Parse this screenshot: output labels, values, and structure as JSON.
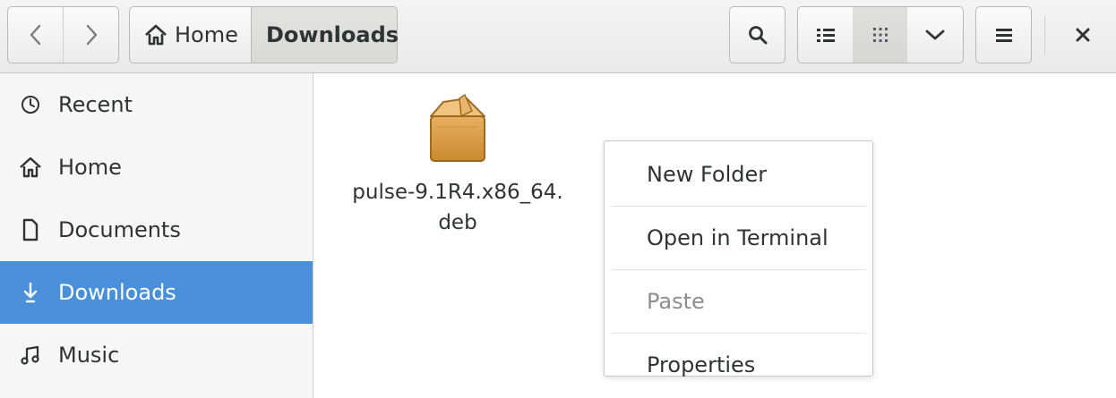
{
  "header": {
    "back_icon": "chevron-left-icon",
    "forward_icon": "chevron-right-icon",
    "breadcrumbs": [
      {
        "label": "Home",
        "icon": "home-icon"
      },
      {
        "label": "Downloads"
      }
    ],
    "buttons": {
      "search_icon": "search-icon",
      "list_view_icon": "list-view-icon",
      "grid_view_icon": "grid-view-icon",
      "view_options_icon": "chevron-down-icon",
      "menu_icon": "hamburger-menu-icon",
      "close_icon": "close-icon"
    }
  },
  "sidebar": {
    "items": [
      {
        "label": "Recent",
        "icon": "clock-icon"
      },
      {
        "label": "Home",
        "icon": "home-icon"
      },
      {
        "label": "Documents",
        "icon": "document-icon"
      },
      {
        "label": "Downloads",
        "icon": "download-arrow-icon",
        "active": true
      },
      {
        "label": "Music",
        "icon": "music-note-icon"
      }
    ]
  },
  "content": {
    "files": [
      {
        "name_line1": "pulse-9.1R4.x86_64.",
        "name_line2": "deb",
        "icon": "package-icon"
      }
    ]
  },
  "context_menu": {
    "items": [
      {
        "label": "New Folder",
        "enabled": true
      },
      {
        "label": "Open in Terminal",
        "enabled": true
      },
      {
        "label": "Paste",
        "enabled": false
      },
      {
        "label": "Properties",
        "enabled": true
      }
    ]
  },
  "colors": {
    "accent": "#4a90d9",
    "sidebar_bg": "#f6f6f5",
    "headerbar_bg": "#eaeae8",
    "disabled_text": "#8b8e8f"
  }
}
